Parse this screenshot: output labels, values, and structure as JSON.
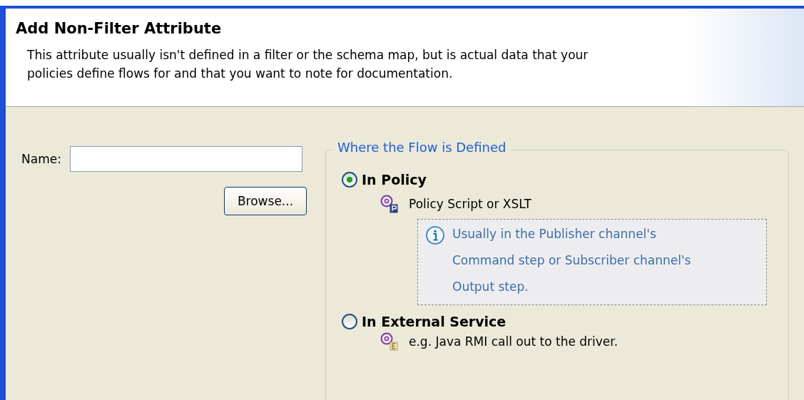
{
  "header": {
    "title": "Add Non-Filter Attribute",
    "description": "This attribute usually isn't defined in a filter or the schema map, but is actual data that your policies define flows for and that you want to note for documentation."
  },
  "name_field": {
    "label": "Name:"
  },
  "browse_button": "Browse...",
  "flow_group": {
    "legend": "Where the Flow is Defined",
    "options": [
      {
        "label": "In Policy",
        "selected": true,
        "detail": {
          "kind": "policy",
          "text": "Policy Script or XSLT"
        },
        "note": "Usually in the Publisher channel's Command step or Subscriber channel's Output step."
      },
      {
        "label": "In External Service",
        "selected": false,
        "detail": {
          "kind": "external",
          "text": "e.g. Java RMI call out to the driver."
        }
      }
    ]
  }
}
